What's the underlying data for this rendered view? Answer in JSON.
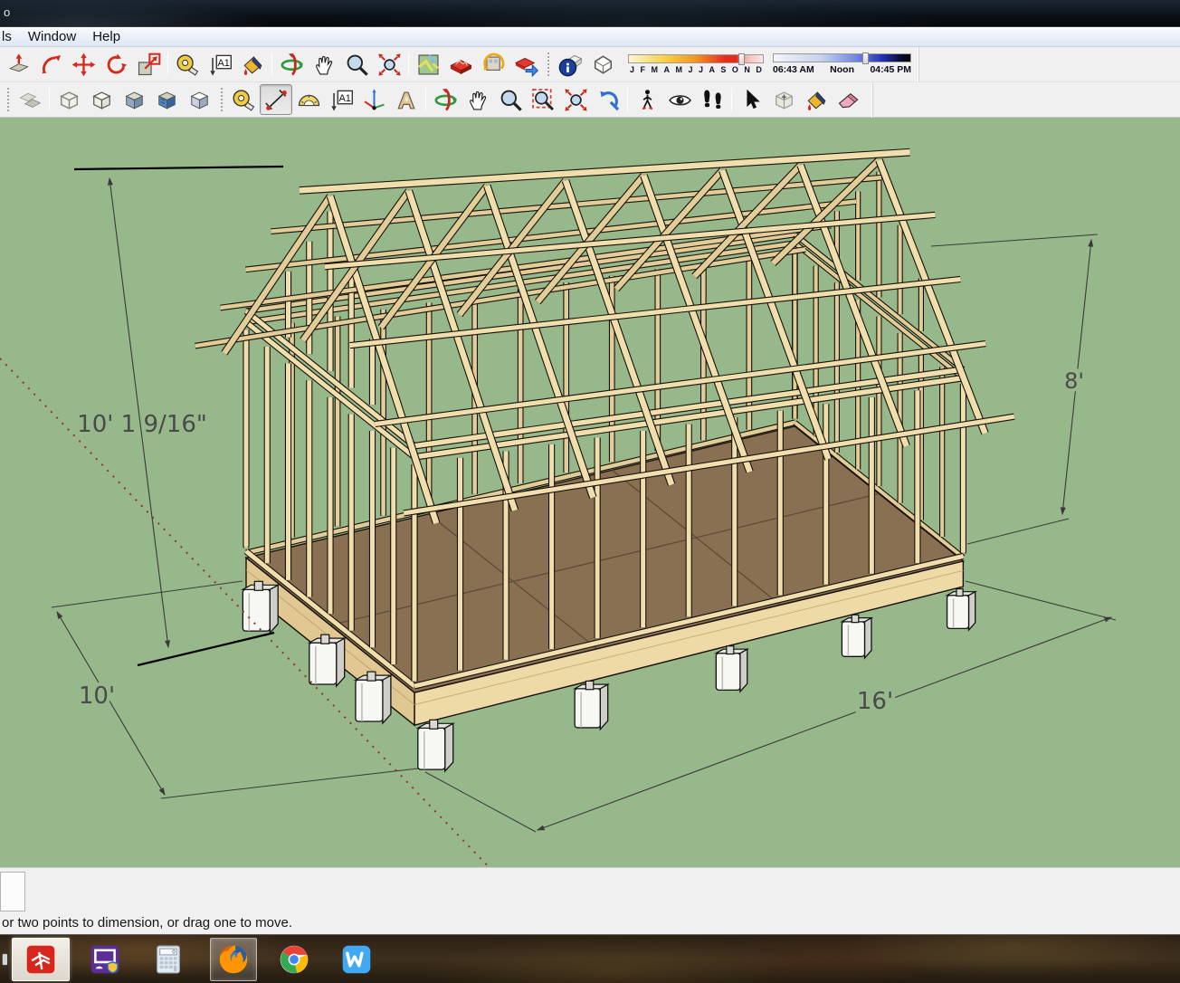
{
  "window": {
    "title": "o"
  },
  "menu": {
    "items": [
      "ls",
      "Window",
      "Help"
    ]
  },
  "toolbar_top": {
    "groups": [
      {
        "lead": "none",
        "icons": [
          "push-pull-icon",
          "follow-me-icon",
          "move-icon",
          "rotate-icon",
          "scale-icon"
        ]
      },
      {
        "lead": "sep",
        "icons": [
          "tape-measure-icon",
          "dimension-text-icon",
          "paint-bucket-icon"
        ]
      },
      {
        "lead": "sep",
        "icons": [
          "orbit-icon",
          "pan-icon",
          "zoom-icon",
          "zoom-extents-icon"
        ]
      },
      {
        "lead": "sep",
        "icons": [
          "add-location-icon",
          "toggle-terrain-icon",
          "photo-textures-icon",
          "share-model-icon"
        ]
      },
      {
        "lead": "grip",
        "icons": [
          "model-info-icon",
          "shadow-box-icon"
        ]
      }
    ],
    "shadow_controls": {
      "months": [
        "J",
        "F",
        "M",
        "A",
        "M",
        "J",
        "J",
        "A",
        "S",
        "O",
        "N",
        "D"
      ],
      "month_slider_pos": 0.84,
      "time_start": "06:43 AM",
      "time_noon": "Noon",
      "time_end": "04:45 PM",
      "time_slider_pos": 0.67
    }
  },
  "toolbar_second": {
    "groups": [
      {
        "lead": "grip",
        "icons": [
          "xray-icon"
        ]
      },
      {
        "lead": "sep",
        "icons": [
          "wireframe-icon",
          "hidden-line-icon",
          "shaded-icon",
          "shaded-textures-icon",
          "monochrome-icon"
        ]
      },
      {
        "lead": "grip",
        "icons": [
          "tape-measure-icon",
          "dimension-tool-icon",
          "protractor-icon",
          "text-annotation-icon",
          "axes-tool-icon",
          "3d-text-icon"
        ],
        "pressed_index": 1
      },
      {
        "lead": "sep",
        "icons": [
          "orbit-icon",
          "pan-icon",
          "zoom-icon",
          "zoom-window-icon",
          "zoom-extents-icon",
          "previous-view-icon"
        ]
      },
      {
        "lead": "sep",
        "icons": [
          "position-camera-icon",
          "look-around-icon",
          "walk-icon"
        ]
      },
      {
        "lead": "sep",
        "icons": [
          "select-icon",
          "make-component-icon",
          "paint-bucket-icon",
          "eraser-icon"
        ]
      }
    ]
  },
  "viewport": {
    "background_color": "#96b88a",
    "dimensions": {
      "height_overall": "10' 1 9/16\"",
      "wall_height": "8'",
      "width": "10'",
      "length": "16'"
    }
  },
  "status": {
    "message": "or two points to dimension, or drag one to move."
  },
  "taskbar": {
    "items": [
      {
        "icon": "edge-sliver-icon",
        "active": false,
        "litebg": false
      },
      {
        "icon": "sketchup-icon",
        "active": true,
        "litebg": true
      },
      {
        "icon": "game-security-icon",
        "active": false,
        "litebg": false
      },
      {
        "icon": "calculator-icon",
        "active": false,
        "litebg": false
      },
      {
        "icon": "firefox-icon",
        "active": true,
        "litebg": false
      },
      {
        "icon": "chrome-icon",
        "active": false,
        "litebg": false
      },
      {
        "icon": "wps-writer-icon",
        "active": false,
        "litebg": false
      }
    ]
  }
}
